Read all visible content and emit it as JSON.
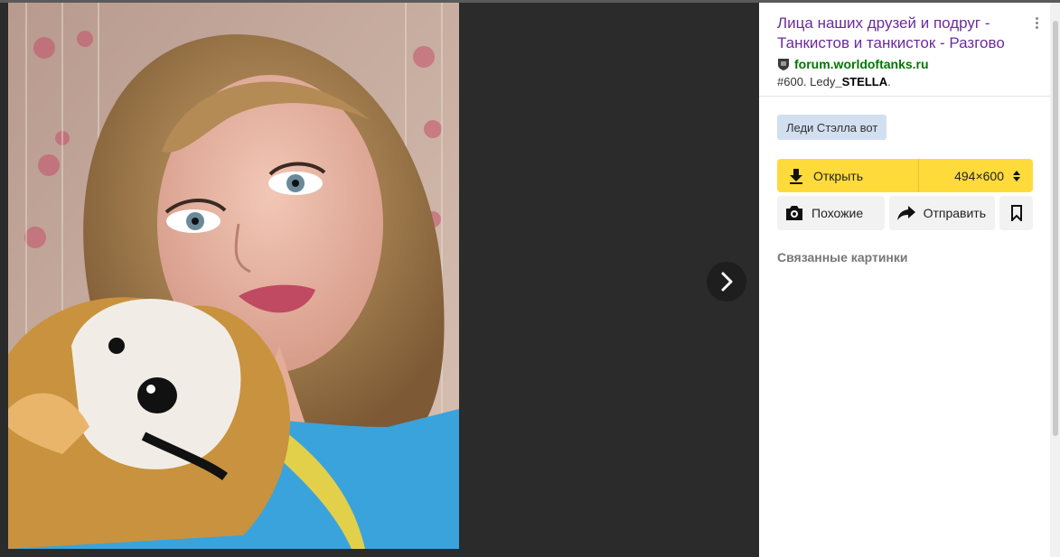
{
  "result": {
    "title": "Лица наших друзей и подруг - Танкистов и танкисток - Разгово",
    "source": "forum.worldoftanks.ru",
    "snippet_prefix": "#600. Ledy",
    "snippet_bold": "_STELLA",
    "snippet_suffix": ".",
    "tag": "Леди Стэлла вот"
  },
  "actions": {
    "open_label": "Открыть",
    "size_label": "494×600",
    "similar_label": "Похожие",
    "send_label": "Отправить"
  },
  "related_label": "Связанные картинки",
  "icons": {
    "next": "chevron-right-icon",
    "source": "worldoftanks-shield-icon",
    "open": "download-icon",
    "size": "sort-arrows-icon",
    "similar": "camera-search-icon",
    "send": "share-arrow-icon",
    "save": "bookmark-icon",
    "more": "more-vertical-icon"
  },
  "colors": {
    "title": "#6b2b9e",
    "source": "#007700",
    "accent": "#fedb3b",
    "tag_bg": "#d2dff0",
    "viewer_bg": "#2b2b2b"
  }
}
